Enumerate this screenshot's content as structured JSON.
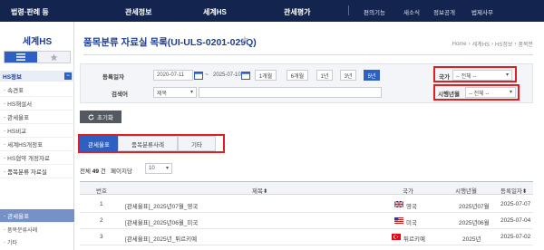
{
  "topnav": {
    "items": [
      "법령·판례 등",
      "관세정보",
      "세계HS",
      "관세평가"
    ],
    "utils": [
      "편의기능",
      "새소식",
      "정보공개",
      "법제사무"
    ]
  },
  "sidebar": {
    "title": "세계HS",
    "section": "HS정보",
    "items": [
      "속견표",
      "HS해설서",
      "관세율표",
      "HS비교",
      "세계HS개정표",
      "HS협약 개정자료",
      "품목분류 자료실"
    ],
    "sub_items": [
      "관세율표",
      "품목분류사례",
      "기타"
    ]
  },
  "page": {
    "title": "품목분류 자료실 목록(UI-ULS-0201-029Q)",
    "breadcrumb": [
      "Home",
      "세계HS",
      "HS정보",
      "품목분"
    ]
  },
  "search": {
    "date_label": "등록일자",
    "date_from": "2020-07-11",
    "date_sep": "~",
    "date_to": "2025-07-10",
    "periods": [
      "1개월",
      "6개월",
      "1년",
      "3년",
      "5년"
    ],
    "active_period": "5년",
    "keyword_label": "검색어",
    "keyword_type": "제목",
    "country_label": "국가",
    "country_value": "-- 전체 --",
    "year_label": "시행년월",
    "year_value": "-- 전체 --",
    "reset_label": "초기화"
  },
  "tabs": [
    "관세율표",
    "품목분류사례",
    "기타"
  ],
  "list": {
    "total_prefix": "전체",
    "total_count": "49",
    "total_suffix": "건",
    "per_page_label": "페이지당",
    "per_page_value": "10"
  },
  "table": {
    "headers": [
      "번호",
      "제목",
      "국가",
      "시행년월",
      "등록일자"
    ],
    "rows": [
      {
        "no": "1",
        "title": "[관세율표]_2025년07월_영국",
        "country": "영국",
        "effective": "2025년07월",
        "registered": "2025-07-07"
      },
      {
        "no": "2",
        "title": "[관세율표]_2025년06월_미국",
        "country": "미국",
        "effective": "2025년06월",
        "registered": "2025-07-04"
      },
      {
        "no": "3",
        "title": "[관세율표]_2025년_튀르키예",
        "country": "튀르키예",
        "effective": "2025년",
        "registered": "2025-07-02"
      }
    ]
  },
  "colors": {
    "nav": "#13254f",
    "accent": "#2e5fc2",
    "highlight": "#e02020"
  }
}
